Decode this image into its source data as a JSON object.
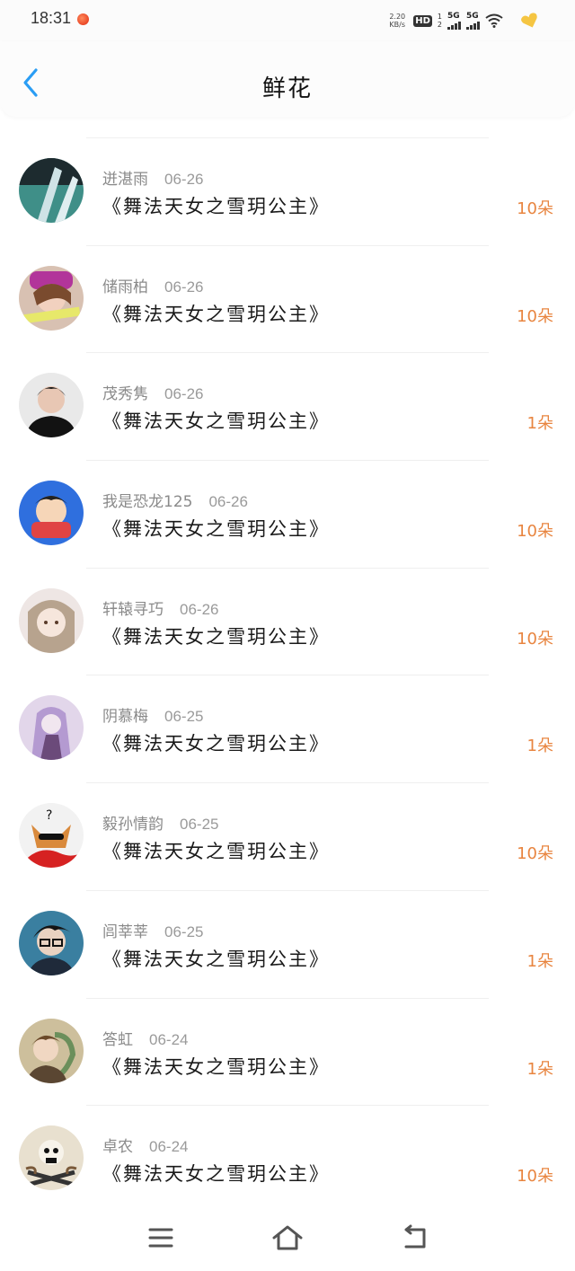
{
  "status_bar": {
    "time": "18:31",
    "net_speed_value": "2.20",
    "net_speed_unit": "KB/s",
    "hd_label": "HD",
    "sim1_index": "1",
    "sim2_index": "2",
    "sig1_label": "5G",
    "sig2_label": "5G"
  },
  "header": {
    "title": "鲜花",
    "back_icon": "chevron-left-icon"
  },
  "colors": {
    "accent": "#2a9df4",
    "count": "#e88540"
  },
  "items": [
    {
      "name": "迸湛雨",
      "date": "06-26",
      "book": "《舞法天女之雪玥公主》",
      "count": "10朵"
    },
    {
      "name": "储雨柏",
      "date": "06-26",
      "book": "《舞法天女之雪玥公主》",
      "count": "10朵"
    },
    {
      "name": "茂秀隽",
      "date": "06-26",
      "book": "《舞法天女之雪玥公主》",
      "count": "1朵"
    },
    {
      "name": "我是恐龙125",
      "date": "06-26",
      "book": "《舞法天女之雪玥公主》",
      "count": "10朵"
    },
    {
      "name": "轩辕寻巧",
      "date": "06-26",
      "book": "《舞法天女之雪玥公主》",
      "count": "10朵"
    },
    {
      "name": "阴慕梅",
      "date": "06-25",
      "book": "《舞法天女之雪玥公主》",
      "count": "1朵"
    },
    {
      "name": "毅孙情韵",
      "date": "06-25",
      "book": "《舞法天女之雪玥公主》",
      "count": "10朵"
    },
    {
      "name": "闾莘莘",
      "date": "06-25",
      "book": "《舞法天女之雪玥公主》",
      "count": "1朵"
    },
    {
      "name": "答虹",
      "date": "06-24",
      "book": "《舞法天女之雪玥公主》",
      "count": "1朵"
    },
    {
      "name": "卓农",
      "date": "06-24",
      "book": "《舞法天女之雪玥公主》",
      "count": "10朵"
    }
  ],
  "nav": {
    "menu_icon": "menu-icon",
    "home_icon": "home-icon",
    "back_icon": "back-icon"
  }
}
